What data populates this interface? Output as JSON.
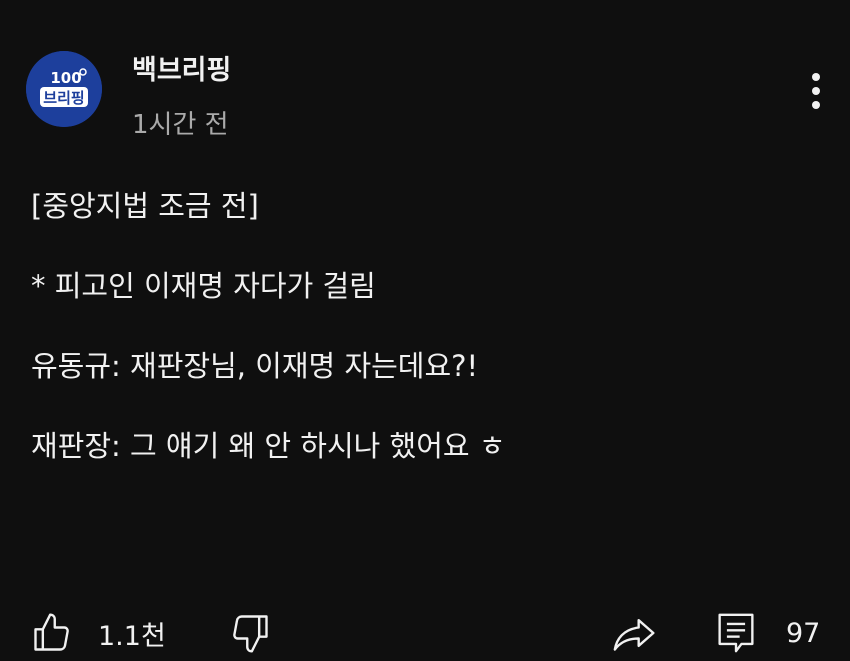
{
  "channel": {
    "name": "백브리핑",
    "timestamp": "1시간 전",
    "avatar_text": "100 브리핑"
  },
  "post": {
    "lines": [
      "[중앙지법 조금 전]",
      "",
      "* 피고인 이재명 자다가 걸림",
      "",
      "유동규: 재판장님, 이재명 자는데요?!",
      "",
      "재판장: 그 얘기 왜 안 하시나 했어요 ㅎ"
    ]
  },
  "actions": {
    "like_count": "1.1천",
    "comment_count": "97"
  },
  "colors": {
    "background": "#0f0f0f",
    "text": "#f1f1f1",
    "secondary_text": "#aaaaaa",
    "avatar_bg": "#1d3f9c"
  },
  "icons": [
    "thumbs-up-icon",
    "thumbs-down-icon",
    "share-icon",
    "comment-icon",
    "more-vert-icon"
  ]
}
